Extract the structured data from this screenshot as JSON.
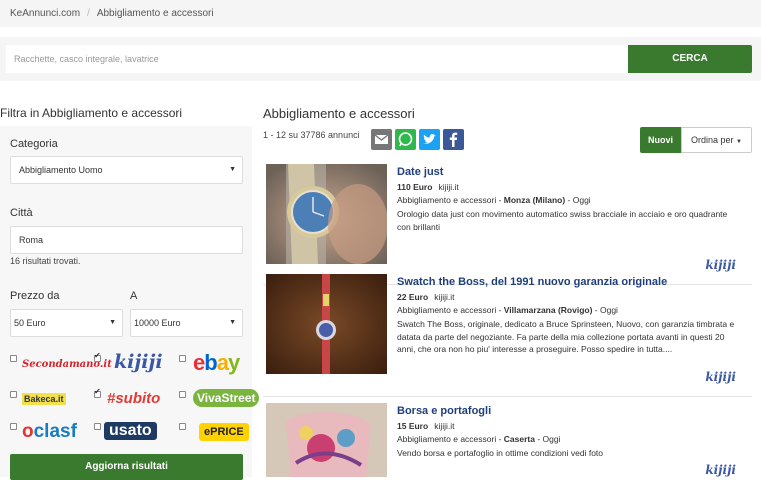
{
  "breadcrumb": {
    "home": "KeAnnunci.com",
    "separator": "/",
    "current": "Abbigliamento e accessori"
  },
  "search": {
    "placeholder": "Racchette, casco integrale, lavatrice",
    "button": "CERCA"
  },
  "sidebar": {
    "title": "Filtra in Abbigliamento e accessori",
    "category_label": "Categoria",
    "category_value": "Abbigliamento Uomo",
    "city_label": "Città",
    "city_value": "Roma",
    "city_results": "16 risultati trovati.",
    "price_from_label": "Prezzo da",
    "price_to_label": "A",
    "price_from_value": "50 Euro",
    "price_to_value": "10000 Euro",
    "sources": [
      {
        "name": "Secondamano.it",
        "checked": false
      },
      {
        "name": "kijiji",
        "checked": true
      },
      {
        "name": "ebay",
        "checked": false
      },
      {
        "name": "Bakeca.it",
        "checked": false
      },
      {
        "name": "subito",
        "checked": true
      },
      {
        "name": "VivaStreet",
        "checked": false
      },
      {
        "name": "clasf",
        "checked": false
      },
      {
        "name": "usato",
        "checked": false
      },
      {
        "name": "ePRICE",
        "checked": false
      }
    ],
    "update_button": "Aggiorna risultati"
  },
  "main": {
    "title": "Abbigliamento e accessori",
    "count": "1 - 12 su 37786 annunci",
    "sort_active": "Nuovi",
    "sort_menu": "Ordina per"
  },
  "listings": [
    {
      "title": "Date just",
      "price": "110 Euro",
      "source": "kijiji.it",
      "meta_prefix": "Abbigliamento e accessori - ",
      "location": "Monza (Milano)",
      "meta_suffix": " - Oggi",
      "description": "Orologio data just con movimento automatico swiss bracciale in acciaio e oro quadrante con brillanti",
      "source_logo": "kijiji"
    },
    {
      "title": "Swatch the Boss, del 1991 nuovo garanzia originale",
      "price": "22 Euro",
      "source": "kijiji.it",
      "meta_prefix": "Abbigliamento e accessori - ",
      "location": "Villamarzana (Rovigo)",
      "meta_suffix": " - Oggi",
      "description": "Swatch The Boss, originale, dedicato a Bruce Sprinsteen, Nuovo, con garanzia timbrata e datata da parte del negoziante. Fa parte della mia collezione portata avanti in questi 20 anni, che ora non ho piu' interesse a proseguire. Posso spedire in tutta....",
      "source_logo": "kijiji"
    },
    {
      "title": "Borsa e portafogli",
      "price": "15 Euro",
      "source": "kijiji.it",
      "meta_prefix": "Abbigliamento e accessori - ",
      "location": "Caserta",
      "meta_suffix": " - Oggi",
      "description": "Vendo borsa e portafoglio in ottime condizioni vedi foto",
      "source_logo": "kijiji"
    }
  ],
  "colors": {
    "green": "#3a7a2f",
    "link_blue": "#1f3f7a"
  }
}
